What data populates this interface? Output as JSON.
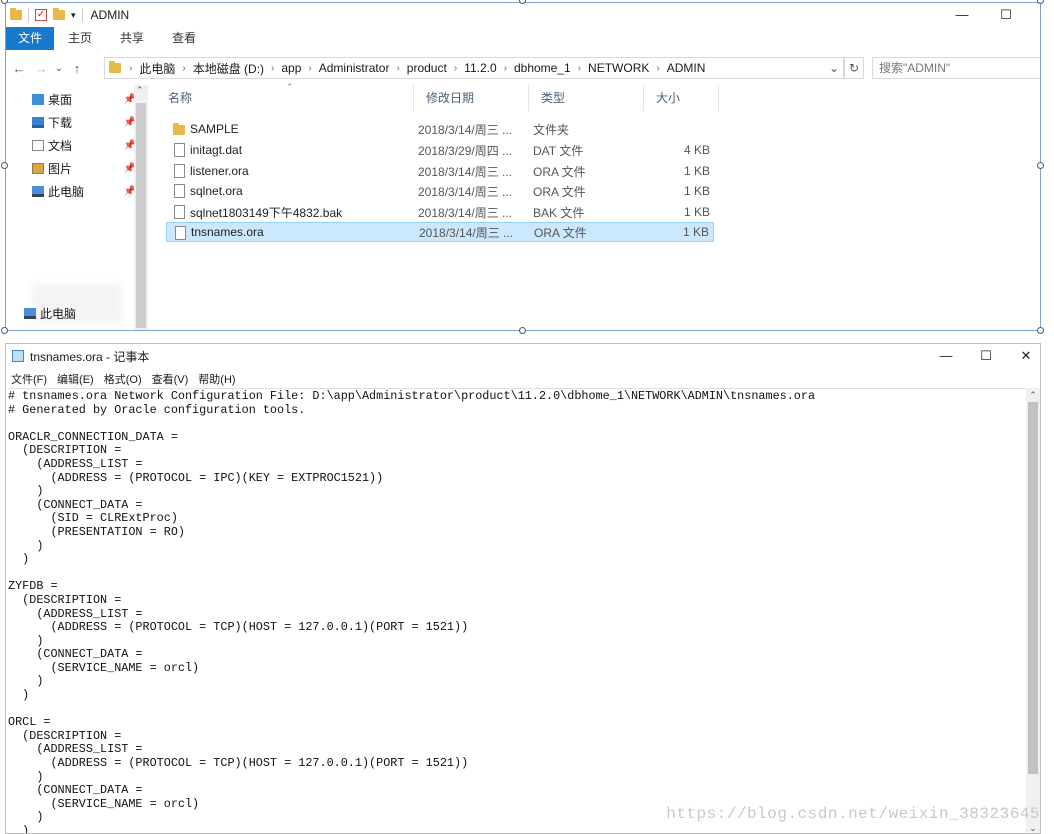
{
  "explorer": {
    "title": "ADMIN",
    "controls": {
      "minimize": "—",
      "maximize": "☐"
    },
    "ribbon_tabs": [
      "文件",
      "主页",
      "共享",
      "查看"
    ],
    "nav_buttons": {
      "back": "←",
      "forward": "→",
      "recent": "⌄",
      "up": "↑"
    },
    "breadcrumb": [
      "此电脑",
      "本地磁盘 (D:)",
      "app",
      "Administrator",
      "product",
      "11.2.0",
      "dbhome_1",
      "NETWORK",
      "ADMIN"
    ],
    "address_dropdown": "⌄",
    "refresh_icon": "↻",
    "search_placeholder": "搜索\"ADMIN\"",
    "nav_pane": [
      {
        "label": "桌面",
        "icon": "desktop-icon"
      },
      {
        "label": "下载",
        "icon": "download-icon"
      },
      {
        "label": "文档",
        "icon": "document-icon"
      },
      {
        "label": "图片",
        "icon": "picture-icon"
      },
      {
        "label": "此电脑",
        "icon": "computer-icon"
      }
    ],
    "nav_bottom": "此电脑",
    "pin_glyph": "📌",
    "columns": {
      "name": "名称",
      "date": "修改日期",
      "type": "类型",
      "size": "大小"
    },
    "files": [
      {
        "name": "SAMPLE",
        "date": "2018/3/14/周三 ...",
        "type": "文件夹",
        "size": "",
        "kind": "folder"
      },
      {
        "name": "initagt.dat",
        "date": "2018/3/29/周四 ...",
        "type": "DAT 文件",
        "size": "4 KB",
        "kind": "file"
      },
      {
        "name": "listener.ora",
        "date": "2018/3/14/周三 ...",
        "type": "ORA 文件",
        "size": "1 KB",
        "kind": "file"
      },
      {
        "name": "sqlnet.ora",
        "date": "2018/3/14/周三 ...",
        "type": "ORA 文件",
        "size": "1 KB",
        "kind": "file"
      },
      {
        "name": "sqlnet1803149下午4832.bak",
        "date": "2018/3/14/周三 ...",
        "type": "BAK 文件",
        "size": "1 KB",
        "kind": "file"
      },
      {
        "name": "tnsnames.ora",
        "date": "2018/3/14/周三 ...",
        "type": "ORA 文件",
        "size": "1 KB",
        "kind": "file",
        "selected": true
      }
    ]
  },
  "notepad": {
    "title": "tnsnames.ora - 记事本",
    "controls": {
      "minimize": "—",
      "maximize": "☐",
      "close": "✕"
    },
    "menu": [
      "文件(F)",
      "编辑(E)",
      "格式(O)",
      "查看(V)",
      "帮助(H)"
    ],
    "content": "# tnsnames.ora Network Configuration File: D:\\app\\Administrator\\product\\11.2.0\\dbhome_1\\NETWORK\\ADMIN\\tnsnames.ora\n# Generated by Oracle configuration tools.\n\nORACLR_CONNECTION_DATA =\n  (DESCRIPTION =\n    (ADDRESS_LIST =\n      (ADDRESS = (PROTOCOL = IPC)(KEY = EXTPROC1521))\n    )\n    (CONNECT_DATA =\n      (SID = CLRExtProc)\n      (PRESENTATION = RO)\n    )\n  )\n\nZYFDB =\n  (DESCRIPTION =\n    (ADDRESS_LIST =\n      (ADDRESS = (PROTOCOL = TCP)(HOST = 127.0.0.1)(PORT = 1521))\n    )\n    (CONNECT_DATA =\n      (SERVICE_NAME = orcl)\n    )\n  )\n\nORCL =\n  (DESCRIPTION =\n    (ADDRESS_LIST =\n      (ADDRESS = (PROTOCOL = TCP)(HOST = 127.0.0.1)(PORT = 1521))\n    )\n    (CONNECT_DATA =\n      (SERVICE_NAME = orcl)\n    )\n  )",
    "scroll_up": "⌃",
    "scroll_down": "⌄"
  },
  "watermark": "https://blog.csdn.net/weixin_38323645",
  "colors": {
    "accent": "#1979ca",
    "selection": "#cce8ff",
    "folder": "#e8b948"
  }
}
